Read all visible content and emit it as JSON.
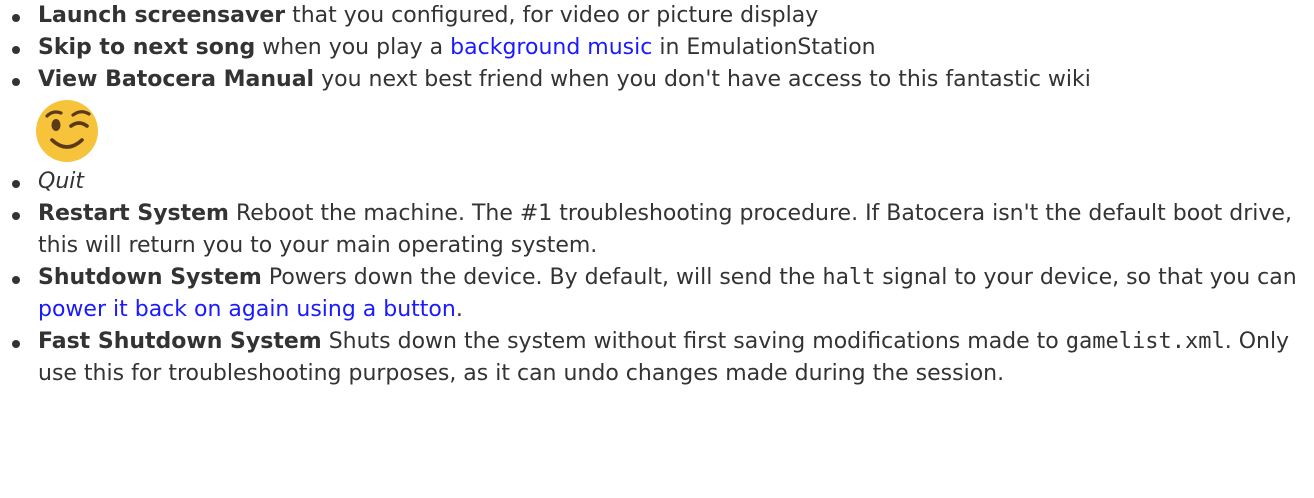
{
  "items": [
    {
      "title": "Launch screensaver",
      "text": " that you configured, for video or picture display"
    },
    {
      "title": "Skip to next song",
      "text_before": " when you play a ",
      "link": "background music",
      "text_after": " in EmulationStation"
    },
    {
      "title": "View Batocera Manual",
      "text": " you next best friend when you don't have access to this fantastic wiki",
      "emoji_icon": "winking-face-icon"
    },
    {
      "text": "Quit"
    },
    {
      "title": "Restart System",
      "text": " Reboot the machine. The #1 troubleshooting procedure. If Batocera isn't the default boot drive, this will return you to your main operating system."
    },
    {
      "title": "Shutdown System",
      "text_before": " Powers down the device. By default, will send the ",
      "code": "halt",
      "text_middle": " signal to your device, so that you can ",
      "link": "power it back on again using a button",
      "text_after": "."
    },
    {
      "title": "Fast Shutdown System",
      "text_before": " Shuts down the system without first saving modifications made to ",
      "code": "gamelist.xml",
      "text_after": ". Only use this for troubleshooting purposes, as it can undo changes made during the session."
    }
  ],
  "colors": {
    "text": "#333333",
    "link": "#1a1aff",
    "emoji_face": "#f7c33b"
  }
}
